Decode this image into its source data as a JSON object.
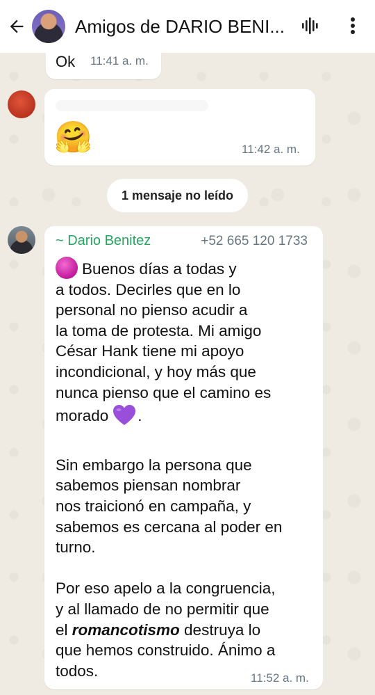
{
  "header": {
    "title": "Amigos de DARIO BENI...",
    "icons": [
      "back-arrow-icon",
      "voice-call-icon",
      "more-options-icon"
    ]
  },
  "messages": {
    "ok_message": {
      "text": "Ok",
      "time": "11:41 a. m."
    },
    "emoji_message": {
      "emoji": "🤗",
      "time": "11:42 a. m."
    },
    "unread_divider": "1 mensaje no leído",
    "main_message": {
      "sender": "~ Dario Benitez",
      "phone": "+52 665 120 1733",
      "lines": {
        "l1": "Buenos días a todas y",
        "l2": "a todos. Decirles que en lo",
        "l3": "personal no pienso acudir a",
        "l4": "la toma de protesta. Mi amigo",
        "l5": "César Hank tiene mi apoyo",
        "l6": "incondicional, y hoy más que",
        "l7": "nunca pienso que el camino es",
        "l8": "morado",
        "l8_end": ".",
        "l9": "Sin embargo la persona que",
        "l10": "sabemos piensan nombrar",
        "l11": "nos traicionó en campaña, y",
        "l12": "sabemos es cercana al poder en",
        "l13": "turno.",
        "l14": "Por eso apelo a la congruencia,",
        "l15": "y al llamado de no permitir que",
        "l16_pre": "el ",
        "l16_bold": "romancotismo",
        "l16_post": " destruya lo",
        "l17": "que hemos construido. Ánimo a",
        "l18": "todos."
      },
      "time": "11:52 a. m."
    }
  },
  "colors": {
    "sender_name": "#25a55f",
    "chat_background": "#efeae2",
    "bubble": "#ffffff",
    "timestamp": "#667781",
    "header_background": "#ffffff"
  }
}
